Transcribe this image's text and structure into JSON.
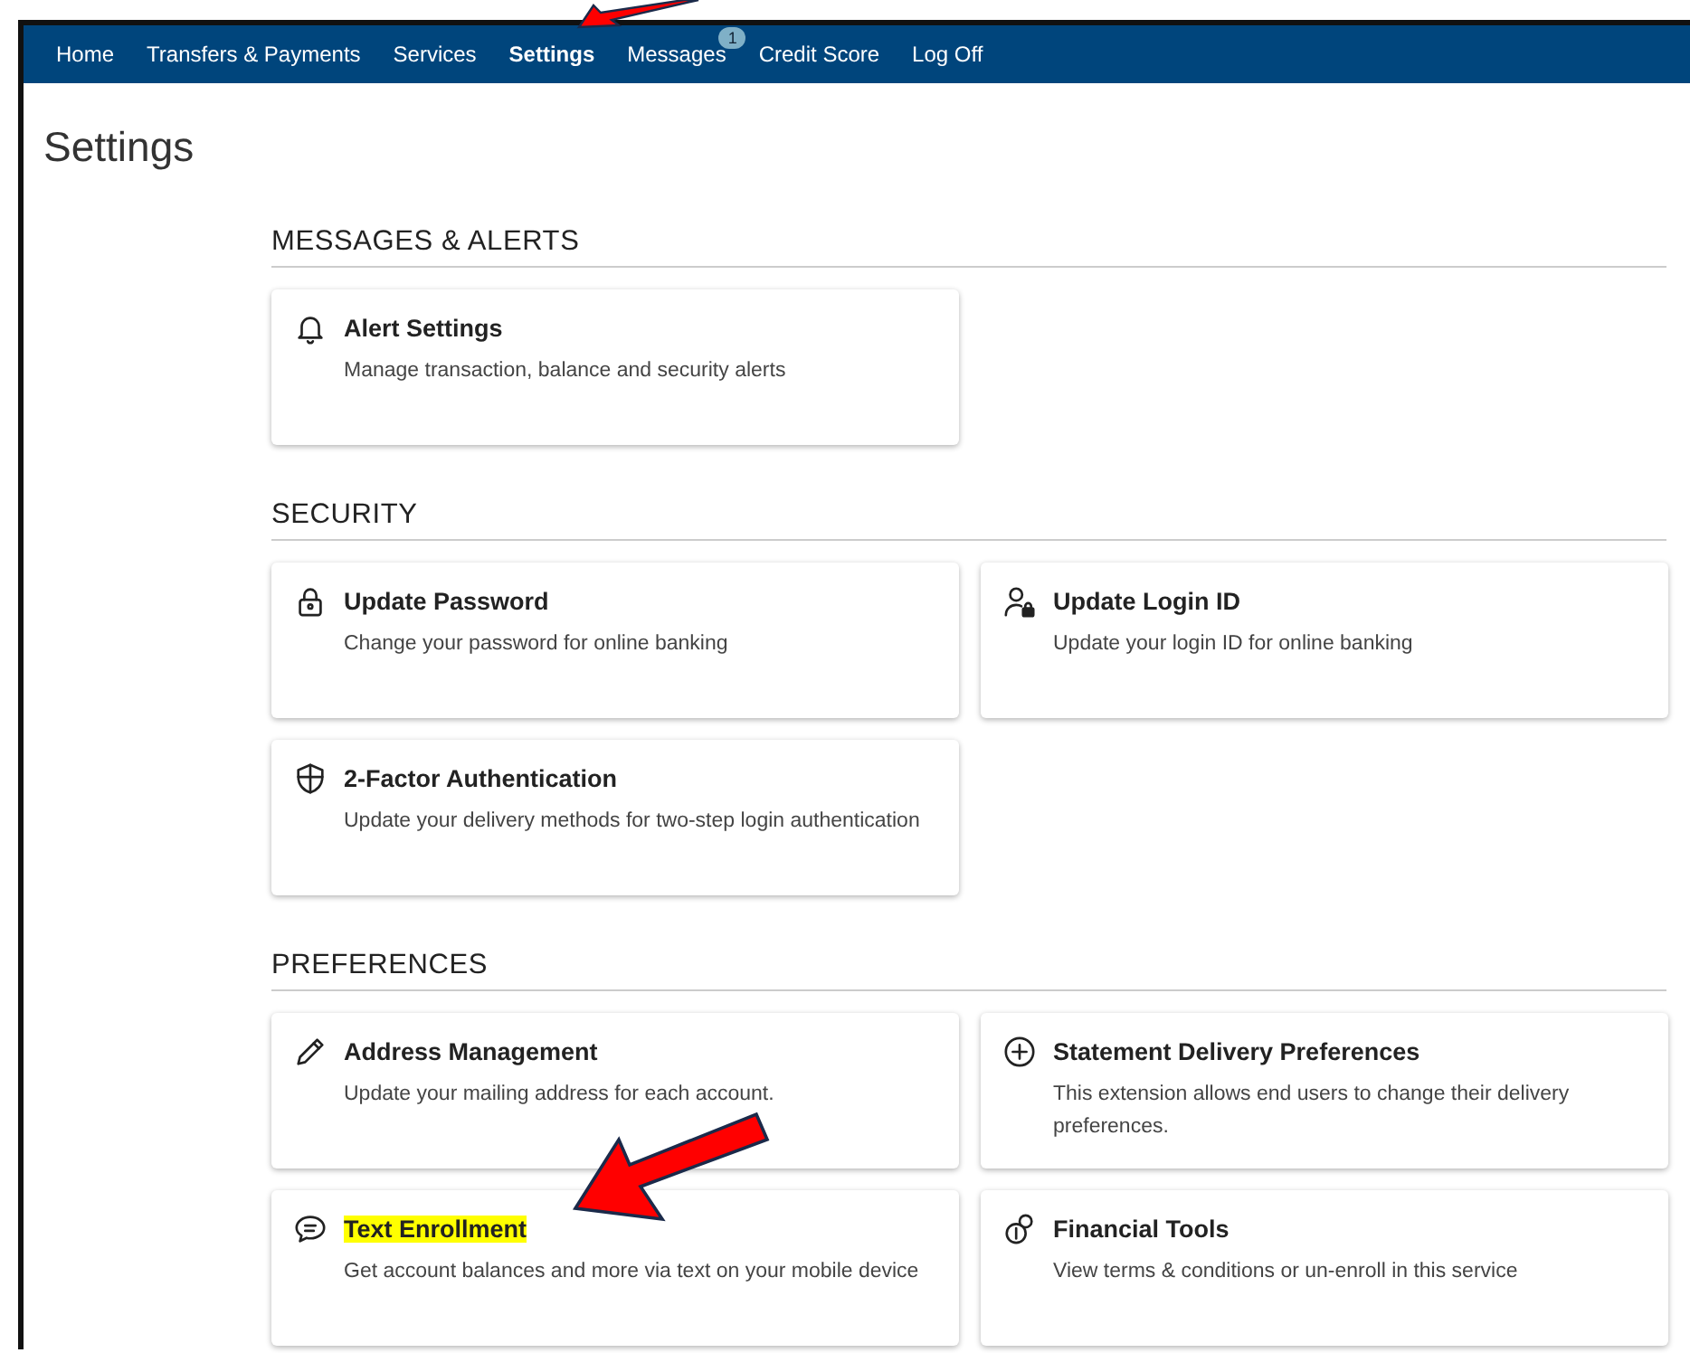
{
  "nav": [
    {
      "label": "Home",
      "selected": false
    },
    {
      "label": "Transfers & Payments",
      "selected": false
    },
    {
      "label": "Services",
      "selected": false
    },
    {
      "label": "Settings",
      "selected": true
    },
    {
      "label": "Messages",
      "selected": false,
      "badge": "1"
    },
    {
      "label": "Credit Score",
      "selected": false
    },
    {
      "label": "Log Off",
      "selected": false
    }
  ],
  "page_title": "Settings",
  "sections": [
    {
      "heading": "MESSAGES & ALERTS",
      "cards": [
        {
          "title": "Alert Settings",
          "description": "Manage transaction, balance and security alerts",
          "highlighted": false
        }
      ]
    },
    {
      "heading": "SECURITY",
      "cards": [
        {
          "title": "Update Password",
          "description": "Change your password for online banking",
          "highlighted": false
        },
        {
          "title": "Update Login ID",
          "description": "Update your login ID for online banking",
          "highlighted": false
        },
        {
          "title": "2-Factor Authentication",
          "description": "Update your delivery methods for two-step login authentication",
          "highlighted": false
        }
      ]
    },
    {
      "heading": "PREFERENCES",
      "cards": [
        {
          "title": "Address Management",
          "description": "Update your mailing address for each account.",
          "highlighted": false
        },
        {
          "title": "Statement Delivery Preferences",
          "description": "This extension allows end users to change their delivery preferences.",
          "highlighted": false
        },
        {
          "title": "Text Enrollment",
          "description": "Get account balances and more via text on your mobile device",
          "highlighted": true
        },
        {
          "title": "Financial Tools",
          "description": "View terms & conditions or un-enroll in this service",
          "highlighted": false
        }
      ]
    }
  ]
}
